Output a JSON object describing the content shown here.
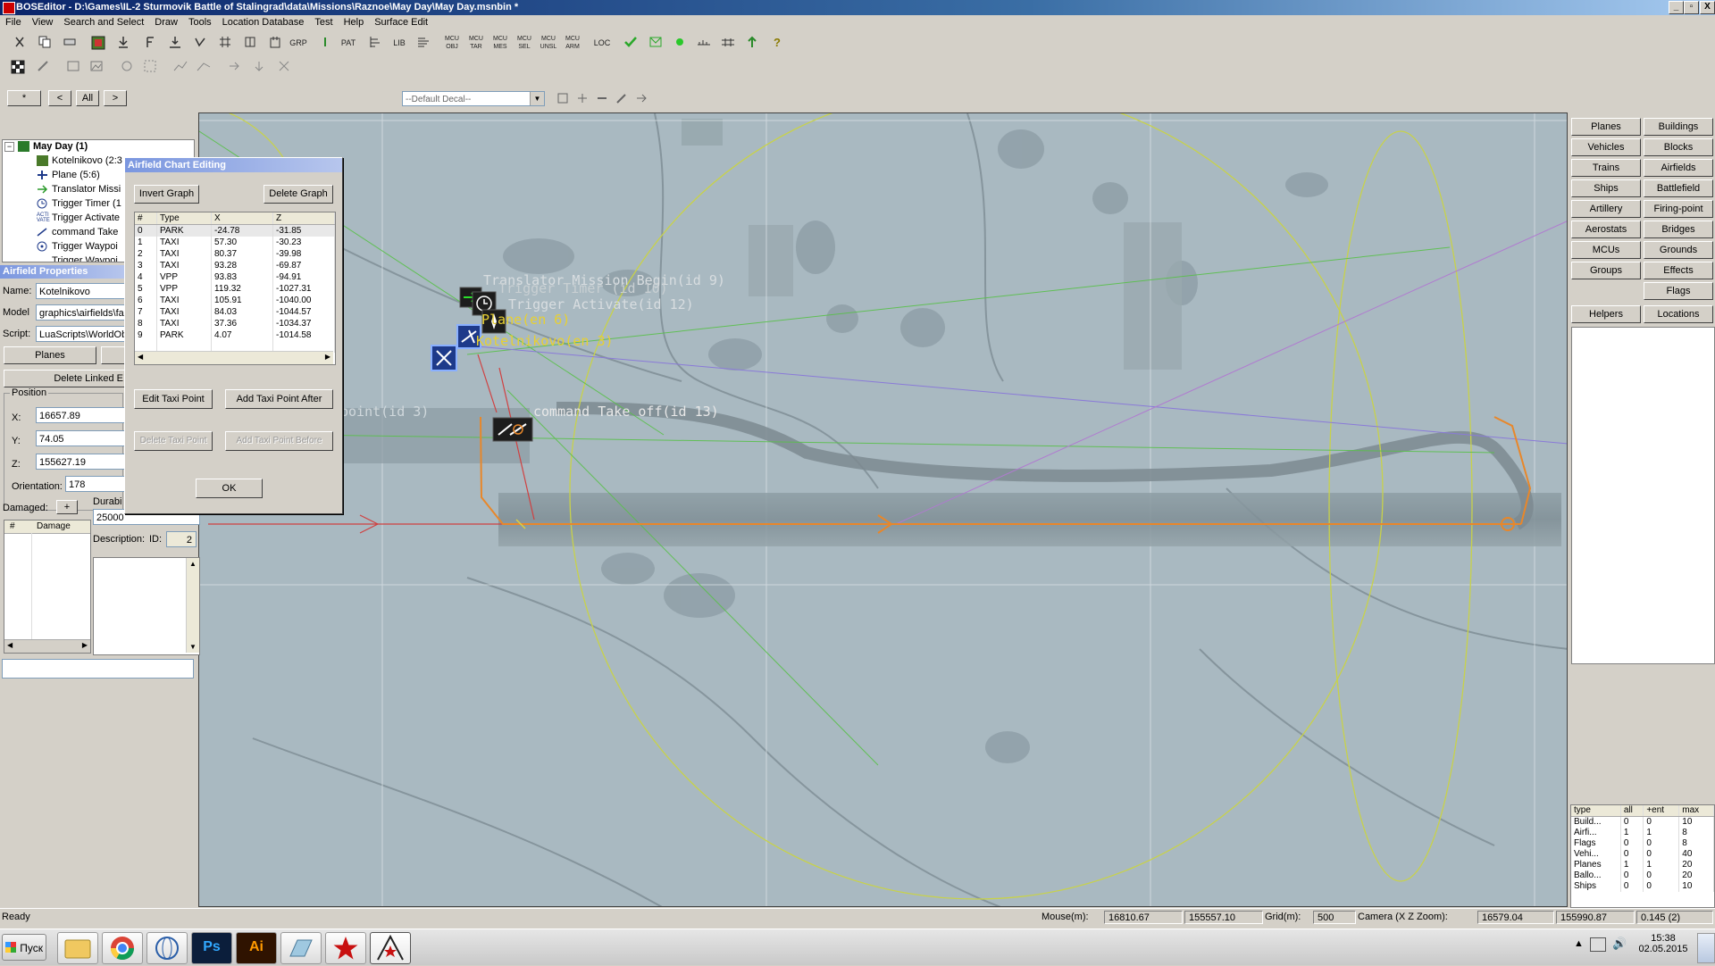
{
  "window": {
    "title": "BOSEditor - D:\\Games\\IL-2 Sturmovik Battle of Stalingrad\\data\\Missions\\Raznoe\\May Day\\May Day.msnbin *",
    "btn_min": "_",
    "btn_max": "▫",
    "btn_close": "X"
  },
  "menu": [
    "File",
    "View",
    "Search and Select",
    "Draw",
    "Tools",
    "Location Database",
    "Test",
    "Help",
    "Surface Edit"
  ],
  "toolbar": {
    "mcu1": "MCU OBJ",
    "mcu2": "MCU TAR",
    "mcu3": "MCU MES",
    "mcu4": "MCU SEL",
    "mcu5": "MCU UNSL",
    "mcu6": "MCU ARM",
    "loc": "LOC",
    "lib": "LIB",
    "pat": "PAT",
    "grp": "GRP"
  },
  "nav": {
    "star": "*",
    "prev": "<",
    "all": "All",
    "next": ">"
  },
  "decal": {
    "select": "--Default Decal--"
  },
  "tree": {
    "root": "May Day (1)",
    "items": [
      "Kotelnikovo (2:3",
      "Plane (5:6)",
      "Translator Missi",
      "Trigger Timer (1",
      "Trigger Activate",
      "command Take",
      "Trigger Waypoi",
      "Trigger Waypoi"
    ]
  },
  "airfield_props": {
    "header": "Airfield Properties",
    "name_label": "Name:",
    "name": "Kotelnikovo",
    "model_label": "Model",
    "model": "graphics\\airfields\\fa",
    "script_label": "Script:",
    "script": "LuaScripts\\WorldOb",
    "planes_btn": "Planes",
    "delete_linked": "Delete Linked E",
    "position_label": "Position",
    "x_label": "X:",
    "x": "16657.89",
    "y_label": "Y:",
    "y": "74.05",
    "z_label": "Z:",
    "z": "155627.19",
    "orientation_label": "Orientation:",
    "orientation": "178",
    "damaged_label": "Damaged:",
    "damaged_plus": "+",
    "dmg_col1": "#",
    "dmg_col2": "Damage",
    "durability_label": "Durabi",
    "durability": "25000",
    "description_label": "Description:",
    "id_label": "ID:",
    "id": "2"
  },
  "dialog": {
    "title": "Airfield Chart Editing",
    "invert": "Invert Graph",
    "delete_graph": "Delete Graph",
    "columns": [
      "#",
      "Type",
      "X",
      "Z"
    ],
    "rows": [
      [
        "0",
        "PARK",
        "-24.78",
        "-31.85"
      ],
      [
        "1",
        "TAXI",
        "57.30",
        "-30.23"
      ],
      [
        "2",
        "TAXI",
        "80.37",
        "-39.98"
      ],
      [
        "3",
        "TAXI",
        "93.28",
        "-69.87"
      ],
      [
        "4",
        "VPP",
        "93.83",
        "-94.91"
      ],
      [
        "5",
        "VPP",
        "119.32",
        "-1027.31"
      ],
      [
        "6",
        "TAXI",
        "105.91",
        "-1040.00"
      ],
      [
        "7",
        "TAXI",
        "84.03",
        "-1044.57"
      ],
      [
        "8",
        "TAXI",
        "37.36",
        "-1034.37"
      ],
      [
        "9",
        "PARK",
        "4.07",
        "-1014.58"
      ]
    ],
    "edit_taxi": "Edit Taxi Point",
    "add_after": "Add Taxi Point After",
    "delete_taxi": "Delete Taxi Point",
    "add_before": "Add Taxi Point Before",
    "ok": "OK"
  },
  "map_labels": {
    "translator": "Translator Mission Begin(id 9)",
    "timer": "Trigger Timer (id 10)",
    "activate": "Trigger Activate(id 12)",
    "plane": "Plane(en 6)",
    "kotelnikovo": "Kotelnikovo(en 3)",
    "waypoint": "point(id 3)",
    "takeoff": "command Take off(id 13)"
  },
  "right_panel": {
    "buttons": [
      [
        "Planes",
        "Buildings"
      ],
      [
        "Vehicles",
        "Blocks"
      ],
      [
        "Trains",
        "Airfields"
      ],
      [
        "Ships",
        "Battlefield"
      ],
      [
        "Artillery",
        "Firing-point"
      ],
      [
        "Aerostats",
        "Bridges"
      ],
      [
        "MCUs",
        "Grounds"
      ],
      [
        "Groups",
        "Effects"
      ],
      [
        "",
        "Flags"
      ]
    ],
    "helpers": "Helpers",
    "locations": "Locations",
    "count_columns": [
      "type",
      "all",
      "+ent",
      "max"
    ],
    "counts": [
      [
        "Build...",
        "0",
        "0",
        "10"
      ],
      [
        "Airfi...",
        "1",
        "1",
        "8"
      ],
      [
        "Flags",
        "0",
        "0",
        "8"
      ],
      [
        "Vehi...",
        "0",
        "0",
        "40"
      ],
      [
        "Planes",
        "1",
        "1",
        "20"
      ],
      [
        "Ballo...",
        "0",
        "0",
        "20"
      ],
      [
        "Ships",
        "0",
        "0",
        "10"
      ]
    ]
  },
  "status": {
    "ready": "Ready",
    "mouse_label": "Mouse(m):",
    "mouse_x": "16810.67",
    "mouse_z": "155557.10",
    "grid_label": "Grid(m):",
    "grid": "500",
    "camera_label": "Camera (X Z Zoom):",
    "cam_x": "16579.04",
    "cam_z": "155990.87",
    "zoom": "0.145 (2)"
  },
  "taskbar": {
    "start": "Пуск",
    "ps": "Ps",
    "ai": "Ai",
    "time": "15:38",
    "date": "02.05.2015"
  },
  "colors": {
    "accent": "#0a246a",
    "route": "#e8872a",
    "map_bg": "#a9b9c1"
  }
}
